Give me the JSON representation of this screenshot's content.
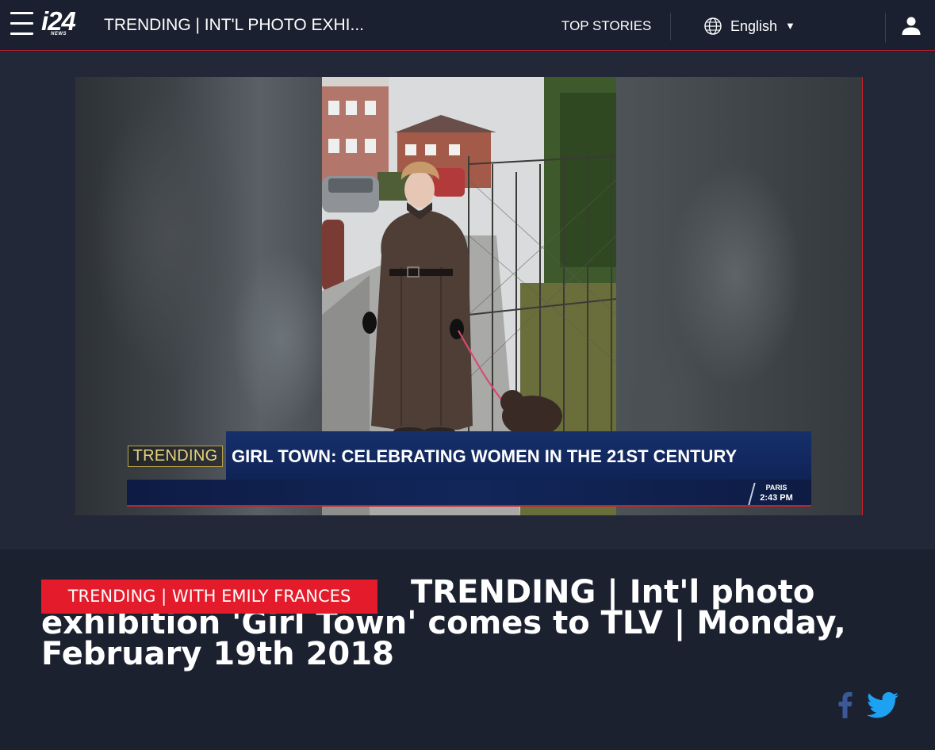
{
  "header": {
    "menu_icon": "hamburger-menu-icon",
    "logo_text": "i24",
    "logo_subtext": "NEWS",
    "title": "TRENDING | INT'L PHOTO EXHI...",
    "nav_top_stories": "TOP STORIES",
    "language": {
      "icon": "globe-icon",
      "label": "English",
      "caret": "▼"
    },
    "user_icon": "user-icon"
  },
  "video": {
    "lower_third": {
      "segment_tag": "TRENDING",
      "headline": "GIRL TOWN: CELEBRATING WOMEN IN THE 21ST CENTURY",
      "city": "PARIS",
      "time": "2:43 PM"
    }
  },
  "article": {
    "tag": "TRENDING | WITH EMILY FRANCES",
    "headline": "TRENDING | Int'l photo exhibition 'Girl Town' comes to TLV | Monday, February 19th 2018"
  },
  "share": {
    "facebook_icon": "facebook-icon",
    "twitter_icon": "twitter-icon",
    "facebook_color": "#3b5998",
    "twitter_color": "#1da1f2"
  },
  "colors": {
    "accent_red": "#e41b2a",
    "background": "#1c2130"
  }
}
